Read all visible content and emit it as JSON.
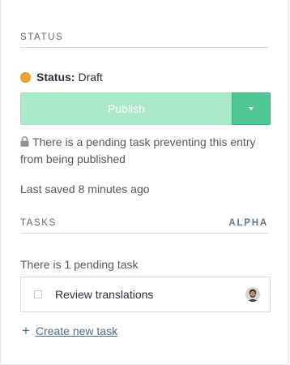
{
  "status_section": {
    "title": "STATUS",
    "status_label": "Status:",
    "status_value": "Draft"
  },
  "publish": {
    "label": "Publish"
  },
  "notice": {
    "text": "There is a pending task preventing this entry from being published"
  },
  "last_saved": "Last saved 8 minutes ago",
  "tasks_section": {
    "title": "TASKS",
    "tag": "ALPHA",
    "pending_count_text": "There is 1 pending task",
    "items": [
      {
        "label": "Review translations",
        "checked": false
      }
    ],
    "create_label": "Create new task"
  },
  "colors": {
    "status_dot": "#f0a52e",
    "publish_disabled": "#a9e8c8",
    "publish_caret": "#4ec795",
    "link": "#4a6d8c"
  },
  "icons": {
    "status": "status-dot-icon",
    "lock": "lock-icon",
    "caret": "chevron-down-icon",
    "plus": "plus-icon"
  }
}
